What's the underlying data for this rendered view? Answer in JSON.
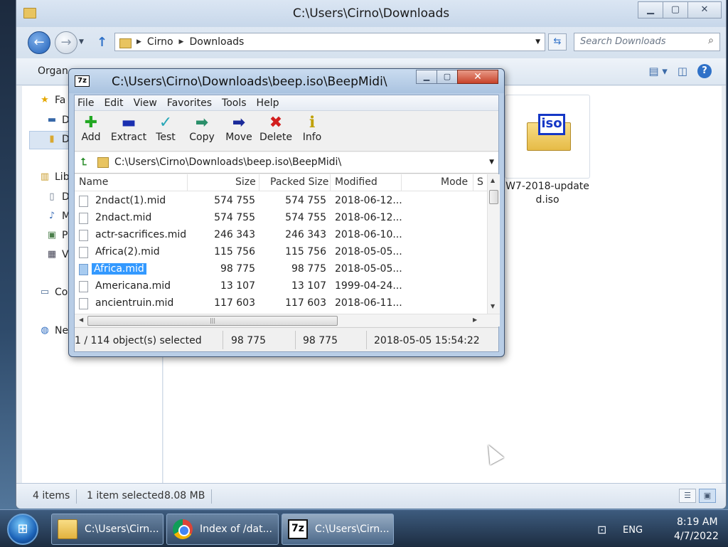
{
  "explorer": {
    "title": "C:\\Users\\Cirno\\Downloads",
    "breadcrumbs": [
      "Cirno",
      "Downloads"
    ],
    "search_placeholder": "Search Downloads",
    "organize_label": "Organ",
    "nav_items": [
      {
        "label": "Fa",
        "icon": "star-icon"
      },
      {
        "label": "D",
        "icon": "desktop-icon"
      },
      {
        "label": "D",
        "icon": "folder-icon"
      },
      {
        "label": "Lib",
        "icon": "libraries-icon"
      },
      {
        "label": "D",
        "icon": "documents-icon"
      },
      {
        "label": "M",
        "icon": "music-icon"
      },
      {
        "label": "P",
        "icon": "pictures-icon"
      },
      {
        "label": "V",
        "icon": "videos-icon"
      },
      {
        "label": "Co",
        "icon": "computer-icon"
      },
      {
        "label": "Ne",
        "icon": "network-icon"
      }
    ],
    "file_tile_name": "W7-2018-update d.iso",
    "iso_badge": "iso",
    "status": {
      "items": "4 items",
      "selected": "1 item selected",
      "size": "8.08 MB"
    }
  },
  "sevenzip": {
    "title": "C:\\Users\\Cirno\\Downloads\\beep.iso\\BeepMidi\\",
    "menu": [
      "File",
      "Edit",
      "View",
      "Favorites",
      "Tools",
      "Help"
    ],
    "toolbar": [
      "Add",
      "Extract",
      "Test",
      "Copy",
      "Move",
      "Delete",
      "Info"
    ],
    "path": "C:\\Users\\Cirno\\Downloads\\beep.iso\\BeepMidi\\",
    "columns": {
      "name": "Name",
      "size": "Size",
      "packed": "Packed Size",
      "modified": "Modified",
      "mode": "Mode",
      "s": "S"
    },
    "rows": [
      {
        "name": "2ndact(1).mid",
        "size": "574 755",
        "packed": "574 755",
        "modified": "2018-06-12..."
      },
      {
        "name": "2ndact.mid",
        "size": "574 755",
        "packed": "574 755",
        "modified": "2018-06-12..."
      },
      {
        "name": "actr-sacrifices.mid",
        "size": "246 343",
        "packed": "246 343",
        "modified": "2018-06-10..."
      },
      {
        "name": "Africa(2).mid",
        "size": "115 756",
        "packed": "115 756",
        "modified": "2018-05-05..."
      },
      {
        "name": "Africa.mid",
        "size": "98 775",
        "packed": "98 775",
        "modified": "2018-05-05..."
      },
      {
        "name": "Americana.mid",
        "size": "13 107",
        "packed": "13 107",
        "modified": "1999-04-24..."
      },
      {
        "name": "ancientruin.mid",
        "size": "117 603",
        "packed": "117 603",
        "modified": "2018-06-11..."
      }
    ],
    "selected_index": 4,
    "status": {
      "selection": "1 / 114 object(s) selected",
      "size": "98 775",
      "packed": "98 775",
      "modified": "2018-05-05 15:54:22"
    }
  },
  "taskbar": {
    "buttons": [
      {
        "label": "C:\\Users\\Cirn...",
        "icon": "folder-icon"
      },
      {
        "label": "Index of /dat...",
        "icon": "chrome-icon"
      },
      {
        "label": "C:\\Users\\Cirn...",
        "icon": "7zip-icon"
      }
    ],
    "language": "ENG",
    "time": "8:19 AM",
    "date": "4/7/2022"
  },
  "colors": {
    "selection": "#3399ff",
    "add": "#22a822",
    "extract": "#1a2fb0",
    "test": "#27a7b7",
    "copy": "#2a8f6a",
    "move": "#1a2a9a",
    "delete": "#d21e1e",
    "info": "#c0a000"
  }
}
